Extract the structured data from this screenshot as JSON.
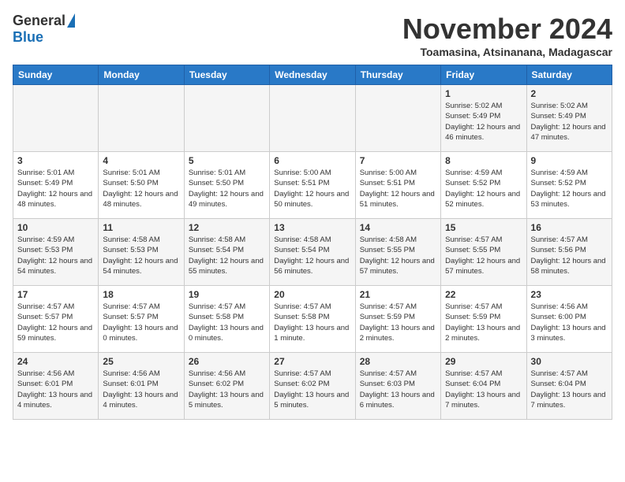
{
  "header": {
    "logo_general": "General",
    "logo_blue": "Blue",
    "month": "November 2024",
    "location": "Toamasina, Atsinanana, Madagascar"
  },
  "weekdays": [
    "Sunday",
    "Monday",
    "Tuesday",
    "Wednesday",
    "Thursday",
    "Friday",
    "Saturday"
  ],
  "weeks": [
    [
      {
        "day": "",
        "info": ""
      },
      {
        "day": "",
        "info": ""
      },
      {
        "day": "",
        "info": ""
      },
      {
        "day": "",
        "info": ""
      },
      {
        "day": "",
        "info": ""
      },
      {
        "day": "1",
        "info": "Sunrise: 5:02 AM\nSunset: 5:49 PM\nDaylight: 12 hours and 46 minutes."
      },
      {
        "day": "2",
        "info": "Sunrise: 5:02 AM\nSunset: 5:49 PM\nDaylight: 12 hours and 47 minutes."
      }
    ],
    [
      {
        "day": "3",
        "info": "Sunrise: 5:01 AM\nSunset: 5:49 PM\nDaylight: 12 hours and 48 minutes."
      },
      {
        "day": "4",
        "info": "Sunrise: 5:01 AM\nSunset: 5:50 PM\nDaylight: 12 hours and 48 minutes."
      },
      {
        "day": "5",
        "info": "Sunrise: 5:01 AM\nSunset: 5:50 PM\nDaylight: 12 hours and 49 minutes."
      },
      {
        "day": "6",
        "info": "Sunrise: 5:00 AM\nSunset: 5:51 PM\nDaylight: 12 hours and 50 minutes."
      },
      {
        "day": "7",
        "info": "Sunrise: 5:00 AM\nSunset: 5:51 PM\nDaylight: 12 hours and 51 minutes."
      },
      {
        "day": "8",
        "info": "Sunrise: 4:59 AM\nSunset: 5:52 PM\nDaylight: 12 hours and 52 minutes."
      },
      {
        "day": "9",
        "info": "Sunrise: 4:59 AM\nSunset: 5:52 PM\nDaylight: 12 hours and 53 minutes."
      }
    ],
    [
      {
        "day": "10",
        "info": "Sunrise: 4:59 AM\nSunset: 5:53 PM\nDaylight: 12 hours and 54 minutes."
      },
      {
        "day": "11",
        "info": "Sunrise: 4:58 AM\nSunset: 5:53 PM\nDaylight: 12 hours and 54 minutes."
      },
      {
        "day": "12",
        "info": "Sunrise: 4:58 AM\nSunset: 5:54 PM\nDaylight: 12 hours and 55 minutes."
      },
      {
        "day": "13",
        "info": "Sunrise: 4:58 AM\nSunset: 5:54 PM\nDaylight: 12 hours and 56 minutes."
      },
      {
        "day": "14",
        "info": "Sunrise: 4:58 AM\nSunset: 5:55 PM\nDaylight: 12 hours and 57 minutes."
      },
      {
        "day": "15",
        "info": "Sunrise: 4:57 AM\nSunset: 5:55 PM\nDaylight: 12 hours and 57 minutes."
      },
      {
        "day": "16",
        "info": "Sunrise: 4:57 AM\nSunset: 5:56 PM\nDaylight: 12 hours and 58 minutes."
      }
    ],
    [
      {
        "day": "17",
        "info": "Sunrise: 4:57 AM\nSunset: 5:57 PM\nDaylight: 12 hours and 59 minutes."
      },
      {
        "day": "18",
        "info": "Sunrise: 4:57 AM\nSunset: 5:57 PM\nDaylight: 13 hours and 0 minutes."
      },
      {
        "day": "19",
        "info": "Sunrise: 4:57 AM\nSunset: 5:58 PM\nDaylight: 13 hours and 0 minutes."
      },
      {
        "day": "20",
        "info": "Sunrise: 4:57 AM\nSunset: 5:58 PM\nDaylight: 13 hours and 1 minute."
      },
      {
        "day": "21",
        "info": "Sunrise: 4:57 AM\nSunset: 5:59 PM\nDaylight: 13 hours and 2 minutes."
      },
      {
        "day": "22",
        "info": "Sunrise: 4:57 AM\nSunset: 5:59 PM\nDaylight: 13 hours and 2 minutes."
      },
      {
        "day": "23",
        "info": "Sunrise: 4:56 AM\nSunset: 6:00 PM\nDaylight: 13 hours and 3 minutes."
      }
    ],
    [
      {
        "day": "24",
        "info": "Sunrise: 4:56 AM\nSunset: 6:01 PM\nDaylight: 13 hours and 4 minutes."
      },
      {
        "day": "25",
        "info": "Sunrise: 4:56 AM\nSunset: 6:01 PM\nDaylight: 13 hours and 4 minutes."
      },
      {
        "day": "26",
        "info": "Sunrise: 4:56 AM\nSunset: 6:02 PM\nDaylight: 13 hours and 5 minutes."
      },
      {
        "day": "27",
        "info": "Sunrise: 4:57 AM\nSunset: 6:02 PM\nDaylight: 13 hours and 5 minutes."
      },
      {
        "day": "28",
        "info": "Sunrise: 4:57 AM\nSunset: 6:03 PM\nDaylight: 13 hours and 6 minutes."
      },
      {
        "day": "29",
        "info": "Sunrise: 4:57 AM\nSunset: 6:04 PM\nDaylight: 13 hours and 7 minutes."
      },
      {
        "day": "30",
        "info": "Sunrise: 4:57 AM\nSunset: 6:04 PM\nDaylight: 13 hours and 7 minutes."
      }
    ]
  ]
}
